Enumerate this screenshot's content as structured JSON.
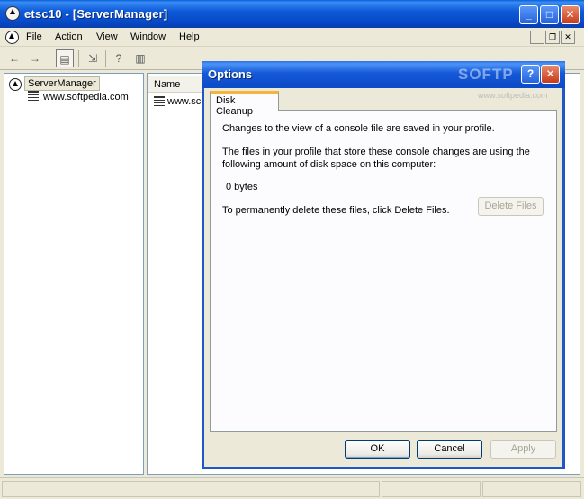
{
  "window": {
    "title": "etsc10 - [ServerManager]",
    "caption_min": "_",
    "caption_max": "□",
    "caption_close": "✕"
  },
  "menubar": {
    "items": [
      "File",
      "Action",
      "View",
      "Window",
      "Help"
    ],
    "mdi_min": "_",
    "mdi_restore": "❐",
    "mdi_close": "✕"
  },
  "toolbar": {
    "back": "←",
    "forward": "→",
    "show_hide_tree": "▤",
    "export": "⇲",
    "help": "?",
    "show_hide_action": "▥"
  },
  "tree": {
    "root_label": "ServerManager",
    "child_label": "www.softpedia.com"
  },
  "list": {
    "column_name": "Name",
    "row_label": "www.sc"
  },
  "dialog": {
    "title": "Options",
    "watermark": "SOFTP",
    "watermark_sub": "www.softpedia.com",
    "help_glyph": "?",
    "close_glyph": "✕",
    "tab_label": "Disk Cleanup",
    "text1": "Changes to the view of a console file are saved in your profile.",
    "text2_line1": "The files in your profile that store these console changes are using the",
    "text2_line2": "following amount of disk space on this computer:",
    "size": "0 bytes",
    "delete_hint": "To permanently delete these files, click Delete Files.",
    "delete_button": "Delete Files",
    "ok_button": "OK",
    "cancel_button": "Cancel",
    "apply_button": "Apply"
  }
}
